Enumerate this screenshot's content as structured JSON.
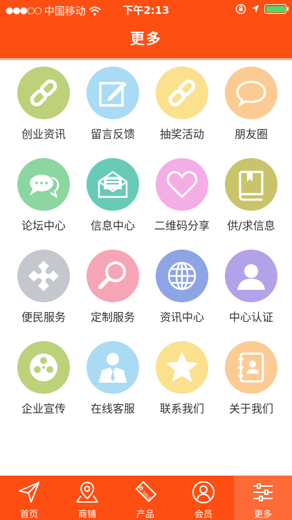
{
  "status": {
    "carrier": "中国移动",
    "time": "下午2:13",
    "battery_color": "#4cd964"
  },
  "header": {
    "title": "更多"
  },
  "grid": [
    {
      "label": "创业资讯",
      "icon": "link-icon",
      "color": "#bcd17a"
    },
    {
      "label": "留言反馈",
      "icon": "edit-icon",
      "color": "#a9dcf4"
    },
    {
      "label": "抽奖活动",
      "icon": "link-icon",
      "color": "#fbe08d"
    },
    {
      "label": "朋友圈",
      "icon": "speech-bubble-icon",
      "color": "#fbcb93"
    },
    {
      "label": "论坛中心",
      "icon": "chat-icon",
      "color": "#8cd69f"
    },
    {
      "label": "信息中心",
      "icon": "mail-icon",
      "color": "#67cbb8"
    },
    {
      "label": "二维码分享",
      "icon": "heart-icon",
      "color": "#f4aee6"
    },
    {
      "label": "供/求信息",
      "icon": "book-icon",
      "color": "#c9c46b"
    },
    {
      "label": "便民服务",
      "icon": "puzzle-icon",
      "color": "#c4c7cd"
    },
    {
      "label": "定制服务",
      "icon": "magnifier-icon",
      "color": "#f6a5b6"
    },
    {
      "label": "资讯中心",
      "icon": "globe-icon",
      "color": "#8da4e5"
    },
    {
      "label": "中心认证",
      "icon": "user-icon",
      "color": "#b4a2e8"
    },
    {
      "label": "企业宣传",
      "icon": "film-reel-icon",
      "color": "#bcd17a"
    },
    {
      "label": "在线客服",
      "icon": "service-person-icon",
      "color": "#a9dcf4"
    },
    {
      "label": "联系我们",
      "icon": "star-icon",
      "color": "#fbe08d"
    },
    {
      "label": "关于我们",
      "icon": "contacts-icon",
      "color": "#fbcb93"
    }
  ],
  "tabs": [
    {
      "label": "首页",
      "icon": "send-icon"
    },
    {
      "label": "商铺",
      "icon": "map-pin-icon"
    },
    {
      "label": "产品",
      "icon": "sale-tag-icon"
    },
    {
      "label": "会员",
      "icon": "member-icon"
    },
    {
      "label": "更多",
      "icon": "sliders-icon",
      "active": true
    }
  ],
  "theme": {
    "accent": "#ff4e12"
  }
}
